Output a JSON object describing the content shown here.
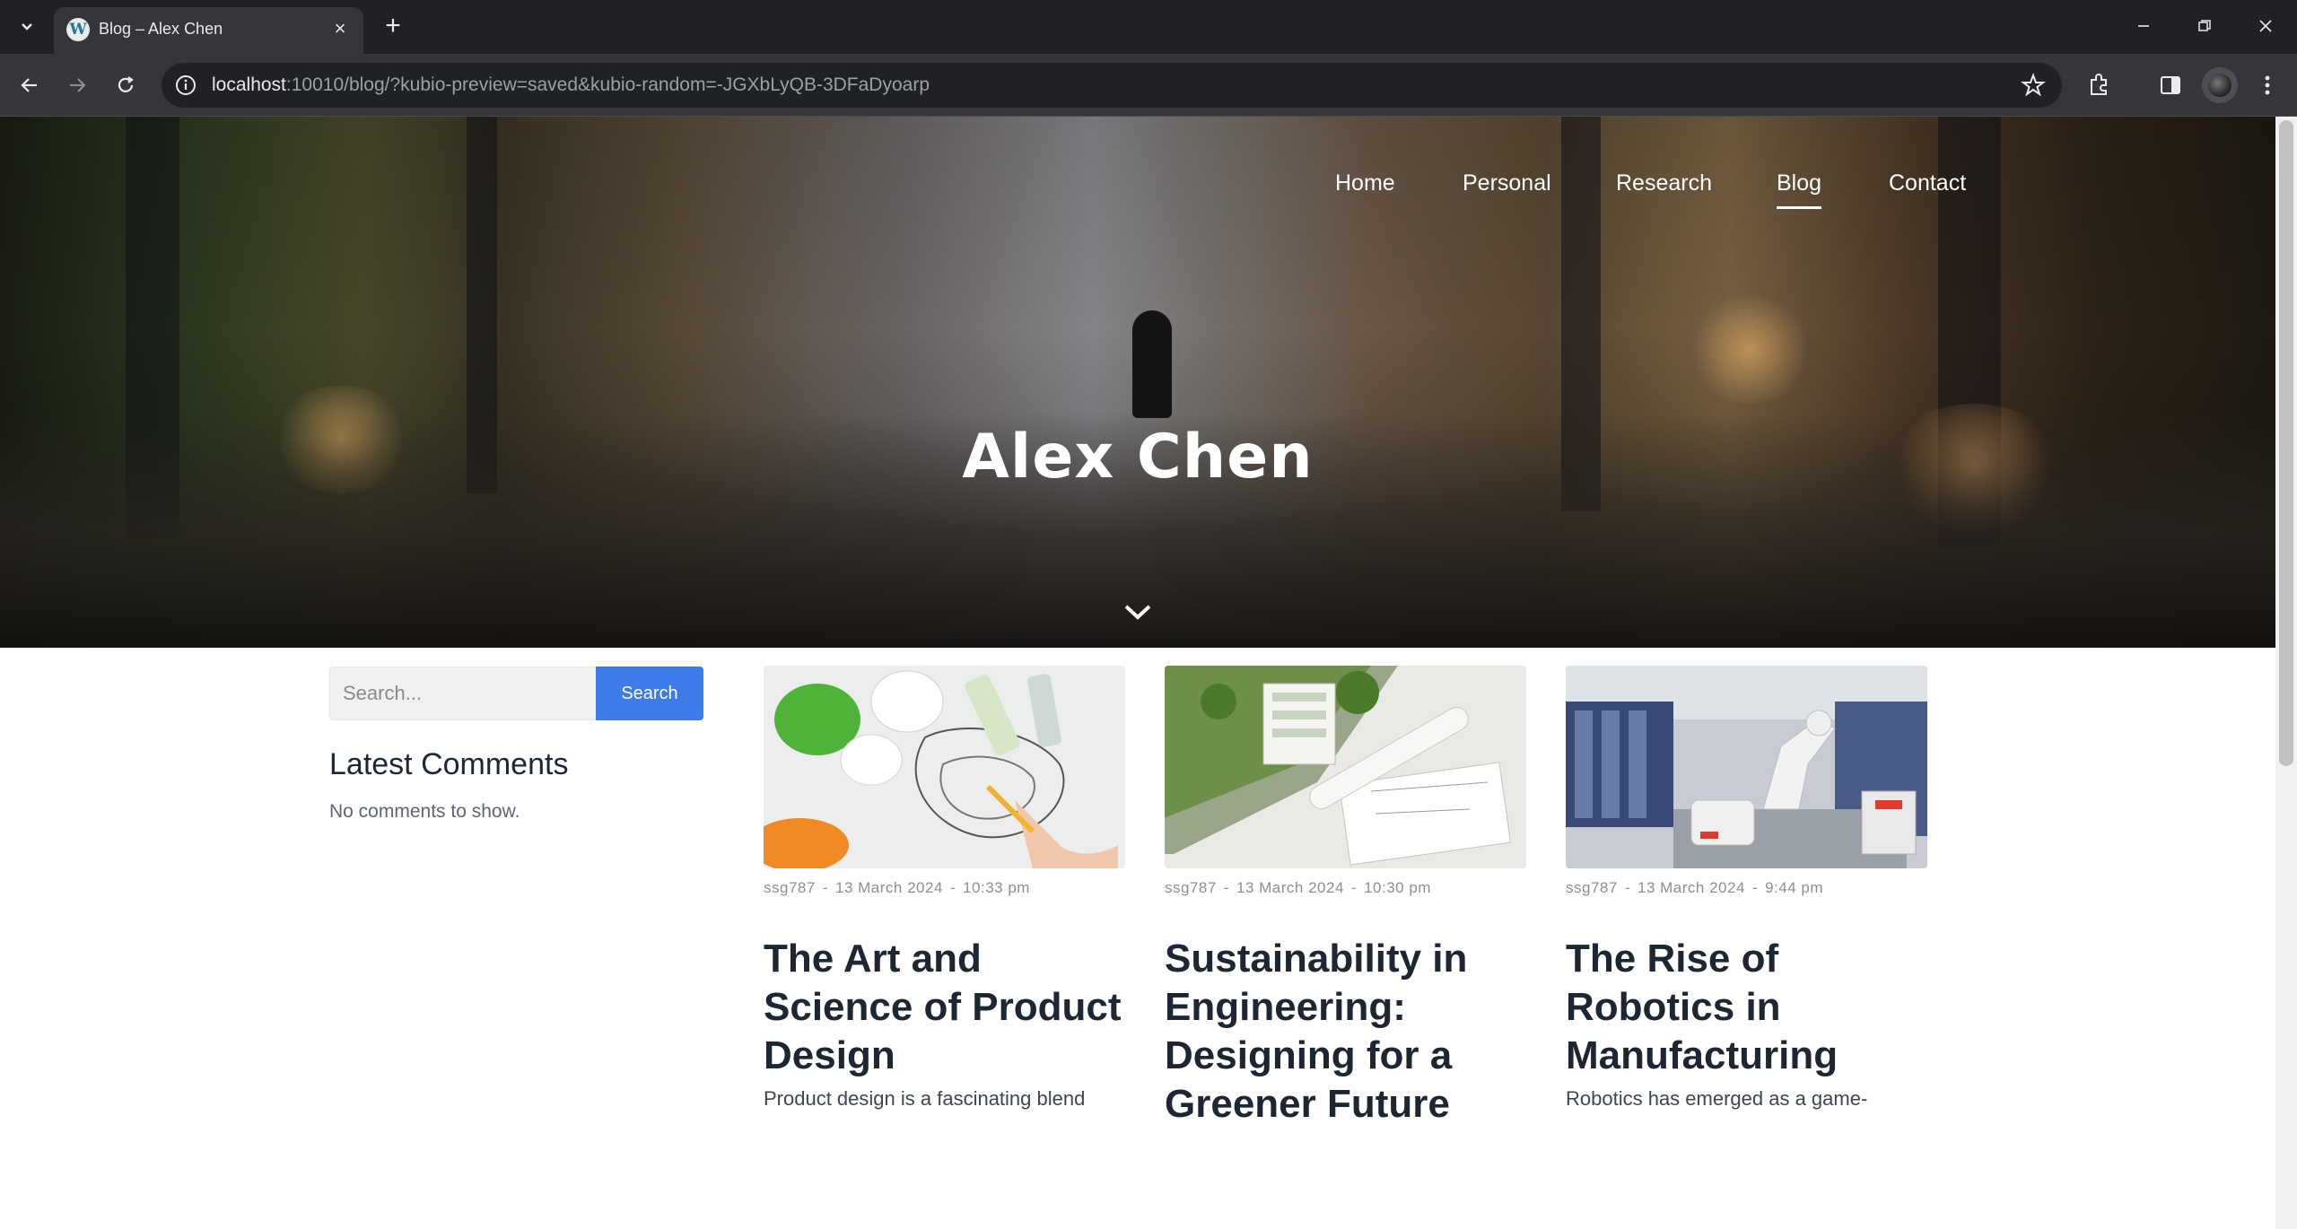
{
  "browser": {
    "tab_title": "Blog – Alex Chen",
    "url_host": "localhost",
    "url_rest": ":10010/blog/?kubio-preview=saved&kubio-random=-JGXbLyQB-3DFaDyoarp"
  },
  "site": {
    "title": "Alex Chen",
    "nav": [
      {
        "label": "Home",
        "active": false
      },
      {
        "label": "Personal",
        "active": false
      },
      {
        "label": "Research",
        "active": false
      },
      {
        "label": "Blog",
        "active": true
      },
      {
        "label": "Contact",
        "active": false
      }
    ]
  },
  "sidebar": {
    "search_placeholder": "Search...",
    "search_button": "Search",
    "comments_title": "Latest Comments",
    "comments_empty": "No comments to show."
  },
  "posts": [
    {
      "author": "ssg787",
      "date": "13 March 2024",
      "time": "10:33 pm",
      "title": "The Art and Science of Product Design",
      "excerpt": "Product design is a fascinating blend",
      "thumb_icon": "product-design-sketch-image"
    },
    {
      "author": "ssg787",
      "date": "13 March 2024",
      "time": "10:30 pm",
      "title": "Sustainability in Engineering: Designing for a Greener Future",
      "excerpt": "",
      "thumb_icon": "green-building-model-image"
    },
    {
      "author": "ssg787",
      "date": "13 March 2024",
      "time": "9:44 pm",
      "title": "The Rise of Robotics in Manufacturing",
      "excerpt": "Robotics has emerged as a game-",
      "thumb_icon": "industrial-robot-image"
    }
  ],
  "colors": {
    "accent": "#3d7be8",
    "heading": "#1d2633",
    "chrome_dark": "#202124",
    "chrome_mid": "#35363a"
  }
}
